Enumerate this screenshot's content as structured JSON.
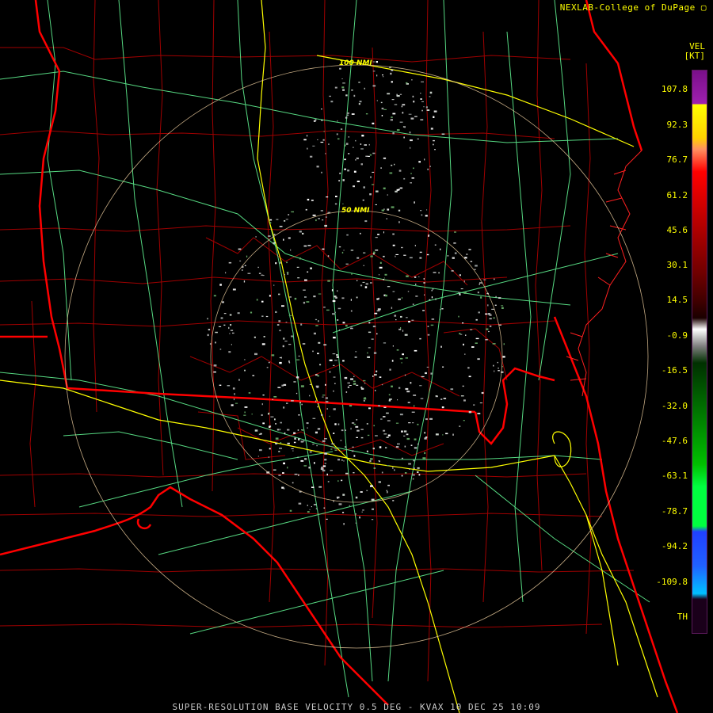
{
  "credit": "NEXLAB-College of DuPage",
  "legend": {
    "product": "VEL",
    "unit": "[KT]",
    "labels": [
      "107.8",
      "92.3",
      "76.7",
      "61.2",
      "45.6",
      "30.1",
      "14.5",
      "-0.9",
      "-16.5",
      "-32.0",
      "-47.6",
      "-63.1",
      "-78.7",
      "-94.2",
      "-109.8",
      "TH"
    ]
  },
  "rings": [
    {
      "label": "100 NMI"
    },
    {
      "label": "50 NMI"
    }
  ],
  "footer": "SUPER-RESOLUTION BASE VELOCITY 0.5 DEG - KVAX 10 DEC 25 10:09",
  "colors": {
    "state_border": "#ff0000",
    "county_border": "#b00000",
    "interstate": "#ffff00",
    "highway": "#66ff99",
    "range_ring": "#e6c89a",
    "text": "#ffff00"
  }
}
